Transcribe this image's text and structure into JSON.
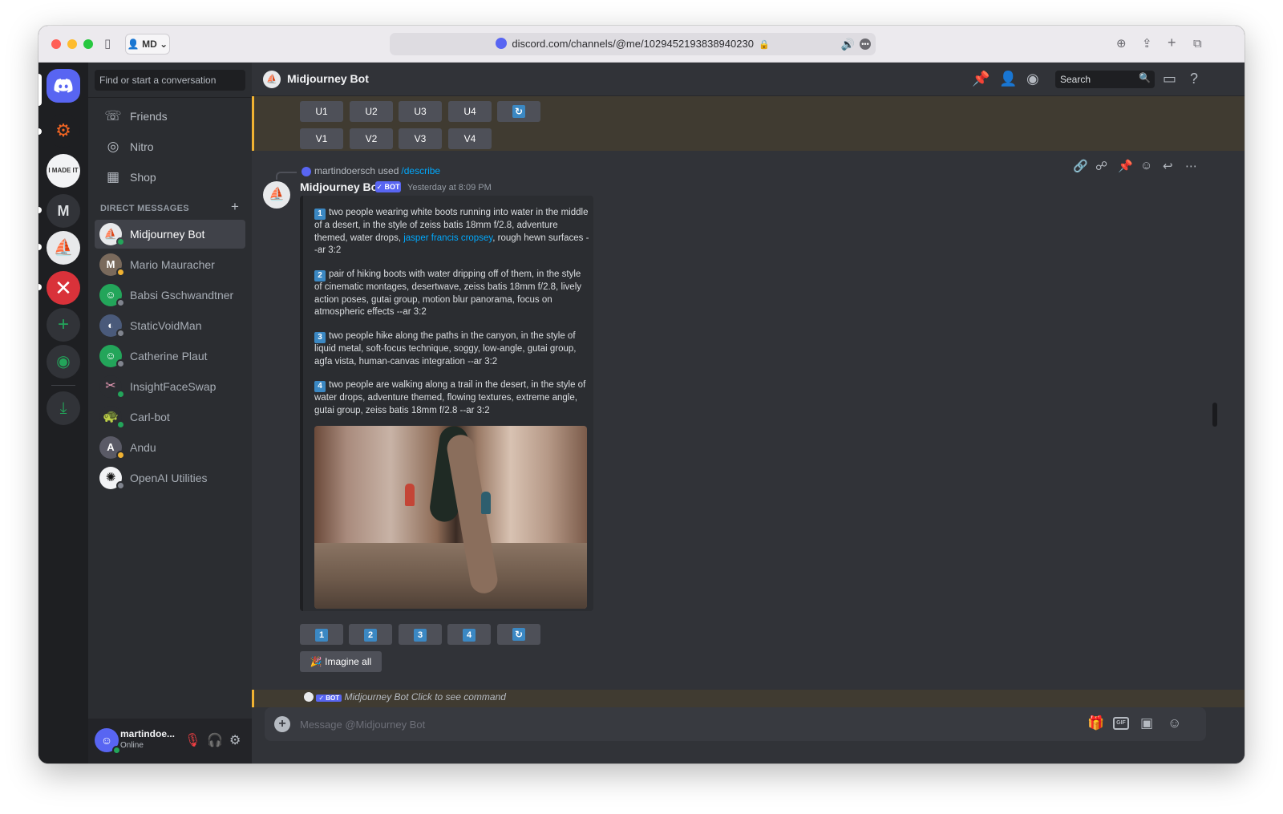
{
  "browser": {
    "profile": "MD",
    "url": "discord.com/channels/@me/1029452193838940230"
  },
  "sidebar": {
    "search_placeholder": "Find or start a conversation",
    "nav": [
      {
        "label": "Friends"
      },
      {
        "label": "Nitro"
      },
      {
        "label": "Shop"
      }
    ],
    "dm_header": "DIRECT MESSAGES",
    "dms": [
      {
        "name": "Midjourney Bot"
      },
      {
        "name": "Mario Mauracher"
      },
      {
        "name": "Babsi Gschwandtner"
      },
      {
        "name": "StaticVoidMan"
      },
      {
        "name": "Catherine Plaut"
      },
      {
        "name": "InsightFaceSwap"
      },
      {
        "name": "Carl-bot"
      },
      {
        "name": "Andu"
      },
      {
        "name": "OpenAI Utilities"
      }
    ],
    "user": {
      "name": "martindoe...",
      "status": "Online"
    }
  },
  "header": {
    "title": "Midjourney Bot",
    "search_placeholder": "Search"
  },
  "top_buttons": {
    "row1": [
      "U1",
      "U2",
      "U3",
      "U4"
    ],
    "row2": [
      "V1",
      "V2",
      "V3",
      "V4"
    ]
  },
  "message": {
    "reply_user": "martindoersch used",
    "reply_command": "/describe",
    "author": "Midjourney Bot",
    "bot_tag": "✓ BOT",
    "timestamp": "Yesterday at 8:09 PM",
    "prompts": [
      {
        "num": "1",
        "text_a": "two people wearing white boots running into water in the middle of a desert, in the style of zeiss batis 18mm f/2.8, adventure themed, water drops, ",
        "link": "jasper francis cropsey",
        "text_b": ", rough hewn surfaces --ar 3:2"
      },
      {
        "num": "2",
        "text_a": "pair of hiking boots with water dripping off of them, in the style of cinematic montages, desertwave, zeiss batis 18mm f/2.8, lively action poses, gutai group, motion blur panorama, focus on atmospheric effects --ar 3:2"
      },
      {
        "num": "3",
        "text_a": "two people hike along the paths in the canyon, in the style of liquid metal, soft-focus technique, soggy, low-angle, gutai group, agfa vista, human-canvas integration --ar 3:2"
      },
      {
        "num": "4",
        "text_a": "two people are walking along a trail in the desert, in the style of water drops, adventure themed, flowing textures, extreme angle, gutai group, zeiss batis 18mm f/2.8 --ar 3:2"
      }
    ],
    "choice_buttons": [
      "1",
      "2",
      "3",
      "4"
    ],
    "imagine_all": "Imagine all"
  },
  "next_message": {
    "bot_tag": "✓ BOT",
    "text": "Midjourney Bot Click to see command"
  },
  "composer": {
    "placeholder": "Message @Midjourney Bot",
    "gif_label": "GIF"
  },
  "colors": {
    "blurple": "#5865f2",
    "online": "#23a55a",
    "idle": "#f0b232",
    "link": "#00a8fc",
    "keycap": "#3b88c3"
  }
}
